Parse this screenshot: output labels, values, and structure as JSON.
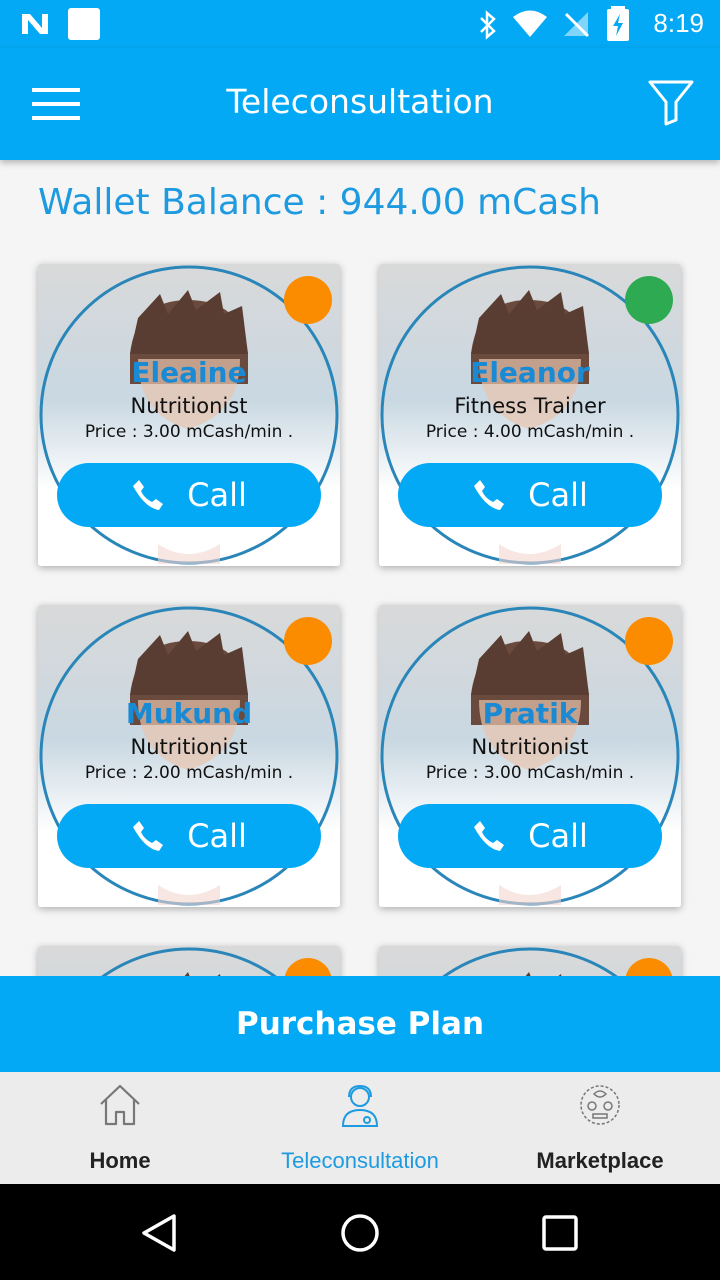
{
  "status_bar": {
    "time": "8:19"
  },
  "app_bar": {
    "title": "Teleconsultation"
  },
  "wallet": {
    "text": "Wallet Balance : 944.00 mCash"
  },
  "consultants": [
    {
      "name": "Eleaine",
      "role": "Nutritionist",
      "price": "Price : 3.00 mCash/min .",
      "status_color": "#fb8c00",
      "call_label": "Call"
    },
    {
      "name": "Eleanor",
      "role": "Fitness Trainer",
      "price": "Price : 4.00 mCash/min .",
      "status_color": "#2eaa52",
      "call_label": "Call"
    },
    {
      "name": "Mukund",
      "role": "Nutritionist",
      "price": "Price : 2.00 mCash/min .",
      "status_color": "#fb8c00",
      "call_label": "Call"
    },
    {
      "name": "Pratik",
      "role": "Nutritionist",
      "price": "Price : 3.00 mCash/min .",
      "status_color": "#fb8c00",
      "call_label": "Call"
    }
  ],
  "purchase_button": {
    "label": "Purchase Plan"
  },
  "bottom_nav": [
    {
      "label": "Home",
      "icon": "home-icon"
    },
    {
      "label": "Teleconsultation",
      "icon": "doctor-icon"
    },
    {
      "label": "Marketplace",
      "icon": "marketplace-icon"
    }
  ],
  "colors": {
    "primary": "#03a9f4",
    "accent_text": "#1e9be0",
    "busy": "#fb8c00",
    "online": "#2eaa52"
  }
}
